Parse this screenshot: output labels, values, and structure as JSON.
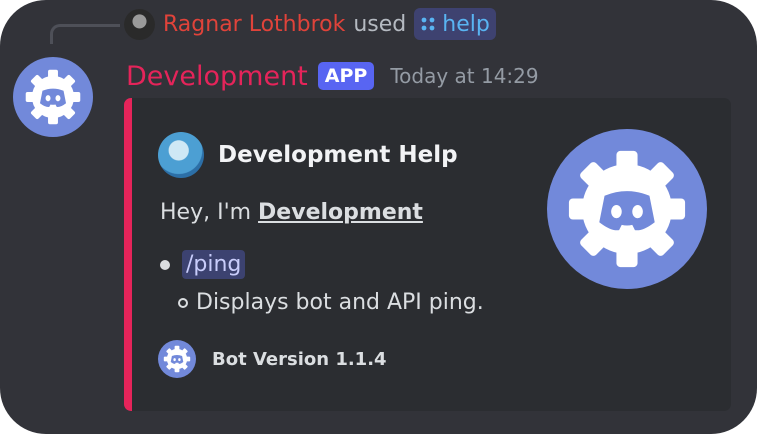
{
  "reply": {
    "username": "Ragnar Lothbrok",
    "used_text": "used",
    "command": "help"
  },
  "message": {
    "bot_name": "Development",
    "app_badge": "APP",
    "timestamp": "Today at 14:29"
  },
  "embed": {
    "author": "Development Help",
    "description_prefix": "Hey, I'm ",
    "description_bold": "Development",
    "command_mention": "/ping",
    "command_description": "Displays bot and API ping.",
    "footer_text": "Bot Version 1.1.4"
  },
  "colors": {
    "accent": "#e5245a",
    "app_badge": "#5865f2",
    "background": "#323339",
    "embed_background": "#2b2d31"
  }
}
